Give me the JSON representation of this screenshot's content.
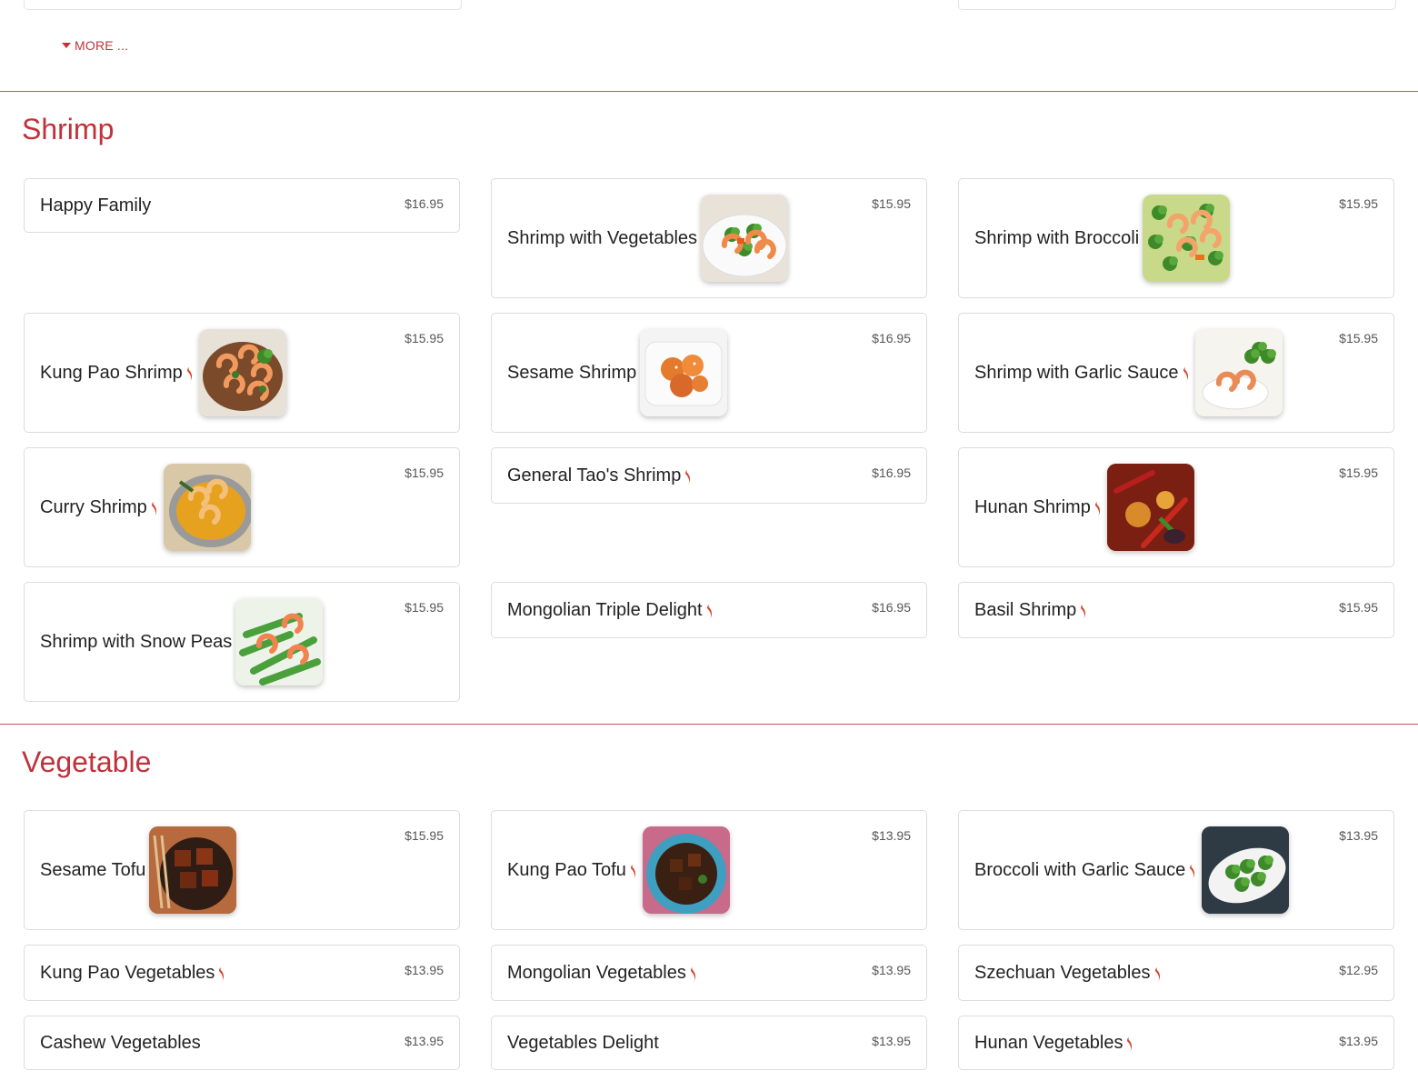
{
  "top": {
    "more_label": "MORE ..."
  },
  "colors": {
    "accent": "#c0323b",
    "divider": "#b85a5e",
    "chili": "#d4442a"
  },
  "sections": [
    {
      "title": "Shrimp",
      "items": [
        {
          "name": "Happy Family",
          "price": "$16.95",
          "spicy": false,
          "image": null
        },
        {
          "name": "Shrimp with Vegetables",
          "price": "$15.95",
          "spicy": false,
          "image": "plate-white"
        },
        {
          "name": "Shrimp with Broccoli",
          "price": "$15.95",
          "spicy": false,
          "image": "broccoli-shrimp"
        },
        {
          "name": "Kung Pao Shrimp",
          "price": "$15.95",
          "spicy": true,
          "image": "kungpao"
        },
        {
          "name": "Sesame Shrimp",
          "price": "$16.95",
          "spicy": false,
          "image": "sesame-orange"
        },
        {
          "name": "Shrimp with Garlic Sauce",
          "price": "$15.95",
          "spicy": true,
          "image": "garlic-shrimp"
        },
        {
          "name": "Curry Shrimp",
          "price": "$15.95",
          "spicy": true,
          "image": "curry"
        },
        {
          "name": "General Tao's Shrimp",
          "price": "$16.95",
          "spicy": true,
          "image": null
        },
        {
          "name": "Hunan Shrimp",
          "price": "$15.95",
          "spicy": true,
          "image": "hunan"
        },
        {
          "name": "Shrimp with Snow Peas",
          "price": "$15.95",
          "spicy": false,
          "image": "snow-peas"
        },
        {
          "name": "Mongolian Triple Delight",
          "price": "$16.95",
          "spicy": true,
          "image": null
        },
        {
          "name": "Basil Shrimp",
          "price": "$15.95",
          "spicy": true,
          "image": null
        }
      ]
    },
    {
      "title": "Vegetable",
      "items": [
        {
          "name": "Sesame Tofu",
          "price": "$15.95",
          "spicy": false,
          "image": "sesame-tofu"
        },
        {
          "name": "Kung Pao Tofu",
          "price": "$13.95",
          "spicy": true,
          "image": "kungpao-tofu"
        },
        {
          "name": "Broccoli with Garlic Sauce",
          "price": "$13.95",
          "spicy": true,
          "image": "broccoli-dish"
        },
        {
          "name": "Kung Pao Vegetables",
          "price": "$13.95",
          "spicy": true,
          "image": null
        },
        {
          "name": "Mongolian Vegetables",
          "price": "$13.95",
          "spicy": true,
          "image": null
        },
        {
          "name": "Szechuan Vegetables",
          "price": "$12.95",
          "spicy": true,
          "image": null
        },
        {
          "name": "Cashew Vegetables",
          "price": "$13.95",
          "spicy": false,
          "image": null
        },
        {
          "name": "Vegetables Delight",
          "price": "$13.95",
          "spicy": false,
          "image": null
        },
        {
          "name": "Hunan Vegetables",
          "price": "$13.95",
          "spicy": true,
          "image": null
        }
      ]
    }
  ]
}
